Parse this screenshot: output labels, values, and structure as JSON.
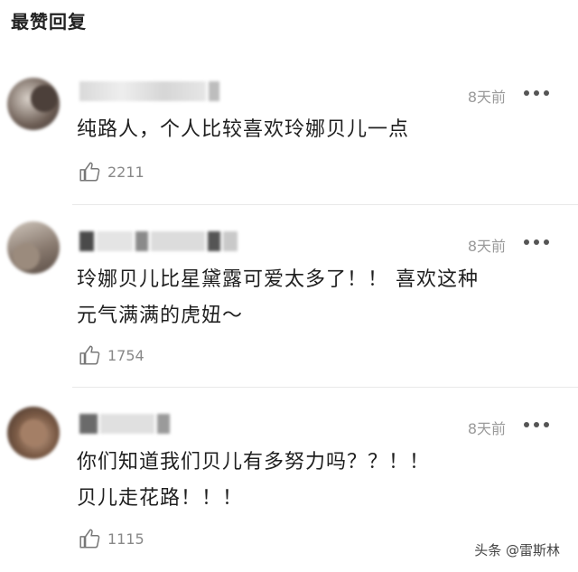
{
  "header": {
    "title": "最赞回复"
  },
  "comments": [
    {
      "time": "8天前",
      "text_lines": [
        "纯路人，个人比较喜欢玲娜贝儿一点"
      ],
      "likes": "2211"
    },
    {
      "time": "8天前",
      "text_lines": [
        "玲娜贝儿比星黛露可爱太多了！！ 喜欢这种",
        "元气满满的虎妞～"
      ],
      "likes": "1754"
    },
    {
      "time": "8天前",
      "text_lines": [
        "你们知道我们贝儿有多努力吗？？！！",
        "贝儿走花路！！！"
      ],
      "likes": "1115"
    }
  ],
  "watermark": "头条 @雷斯林"
}
